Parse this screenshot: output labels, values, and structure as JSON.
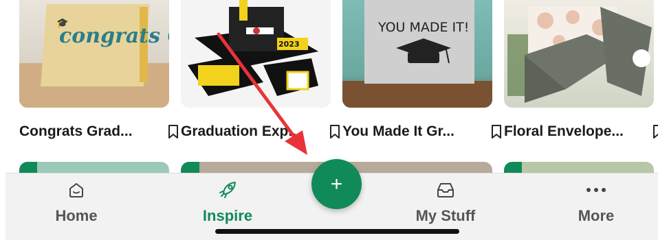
{
  "cards": [
    {
      "title": "Congrats Grad...",
      "art_text": "congrats GRAD!"
    },
    {
      "title": "Graduation Exp...",
      "art_text": "2023"
    },
    {
      "title": "You Made It Gr...",
      "art_text": "YOU MADE IT!"
    },
    {
      "title": "Floral Envelope..."
    }
  ],
  "fab": {
    "label": "+"
  },
  "tabs": [
    {
      "label": "Home",
      "icon": "home-icon"
    },
    {
      "label": "Inspire",
      "icon": "rocket-icon",
      "active": true
    },
    {
      "label": "My Stuff",
      "icon": "inbox-icon"
    },
    {
      "label": "More",
      "icon": "more-dots-icon"
    }
  ],
  "colors": {
    "accent": "#118a5a",
    "annotation": "#e8333a"
  }
}
